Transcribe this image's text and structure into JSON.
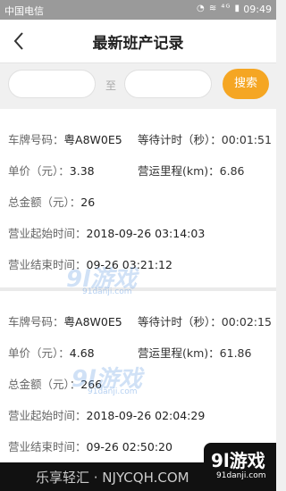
{
  "status_bar": {
    "carrier": "中国电信",
    "icons": "◔ ≋ ⁴ᴳ ▮",
    "battery": "",
    "time": "09:49"
  },
  "header": {
    "title": "最新班产记录"
  },
  "search": {
    "from_value": "",
    "separator": "至",
    "to_value": "",
    "button": "搜索"
  },
  "records": [
    {
      "plate_label": "车牌号码：",
      "plate": "粤A8W0E5",
      "wait_label": "等待计时（秒）：",
      "wait": "00:01:51",
      "price_label": "单价（元）：",
      "price": "3.38",
      "mileage_label": "营运里程(km)：",
      "mileage": "6.86",
      "total_label": "总金额（元）：",
      "total": "26",
      "start_label": "营业起始时间：",
      "start": "2018-09-26 03:14:03",
      "end_label": "营业结束时间：",
      "end": "09-26 03:21:12"
    },
    {
      "plate_label": "车牌号码：",
      "plate": "粤A8W0E5",
      "wait_label": "等待计时（秒）：",
      "wait": "00:02:15",
      "price_label": "单价（元）：",
      "price": "4.68",
      "mileage_label": "营运里程(km)：",
      "mileage": "61.86",
      "total_label": "总金额（元）：",
      "total": "266",
      "start_label": "营业起始时间：",
      "start": "2018-09-26 02:04:29",
      "end_label": "营业结束时间：",
      "end": "09-26 02:50:20"
    }
  ],
  "watermarks": [
    {
      "logo": "9l游戏",
      "url": "91danji.com"
    },
    {
      "logo": "9l游戏",
      "url": "91danji.com"
    }
  ],
  "footer": {
    "left_text": "乐享轻汇 · NJYCQH.COM",
    "logo": "9l游戏",
    "logo_url": "91danji.com"
  }
}
